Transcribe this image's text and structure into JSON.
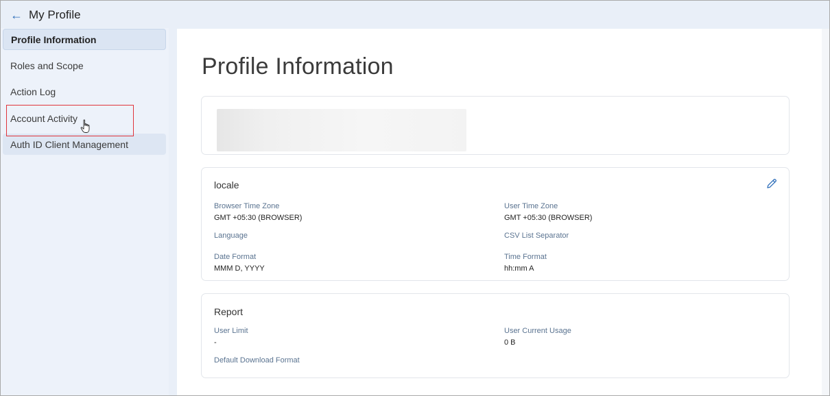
{
  "header": {
    "title": "My Profile"
  },
  "sidebar": {
    "items": [
      {
        "label": "Profile Information"
      },
      {
        "label": "Roles and Scope"
      },
      {
        "label": "Action Log"
      },
      {
        "label": "Account Activity"
      },
      {
        "label": "Auth ID Client Management"
      }
    ]
  },
  "main": {
    "title": "Profile Information",
    "locale": {
      "title": "locale",
      "browser_time_zone_label": "Browser Time Zone",
      "browser_time_zone_value": "GMT +05:30 (BROWSER)",
      "user_time_zone_label": "User Time Zone",
      "user_time_zone_value": "GMT +05:30 (BROWSER)",
      "language_label": "Language",
      "csv_separator_label": "CSV List Separator",
      "date_format_label": "Date Format",
      "date_format_value": "MMM D, YYYY",
      "time_format_label": "Time Format",
      "time_format_value": "hh:mm A"
    },
    "report": {
      "title": "Report",
      "user_limit_label": "User Limit",
      "user_limit_value": "-",
      "user_current_usage_label": "User Current Usage",
      "user_current_usage_value": "0 B",
      "default_download_format_label": "Default Download Format"
    }
  },
  "colors": {
    "accent": "#2f6fba",
    "highlight": "#e0333a",
    "label": "#5a7390"
  }
}
